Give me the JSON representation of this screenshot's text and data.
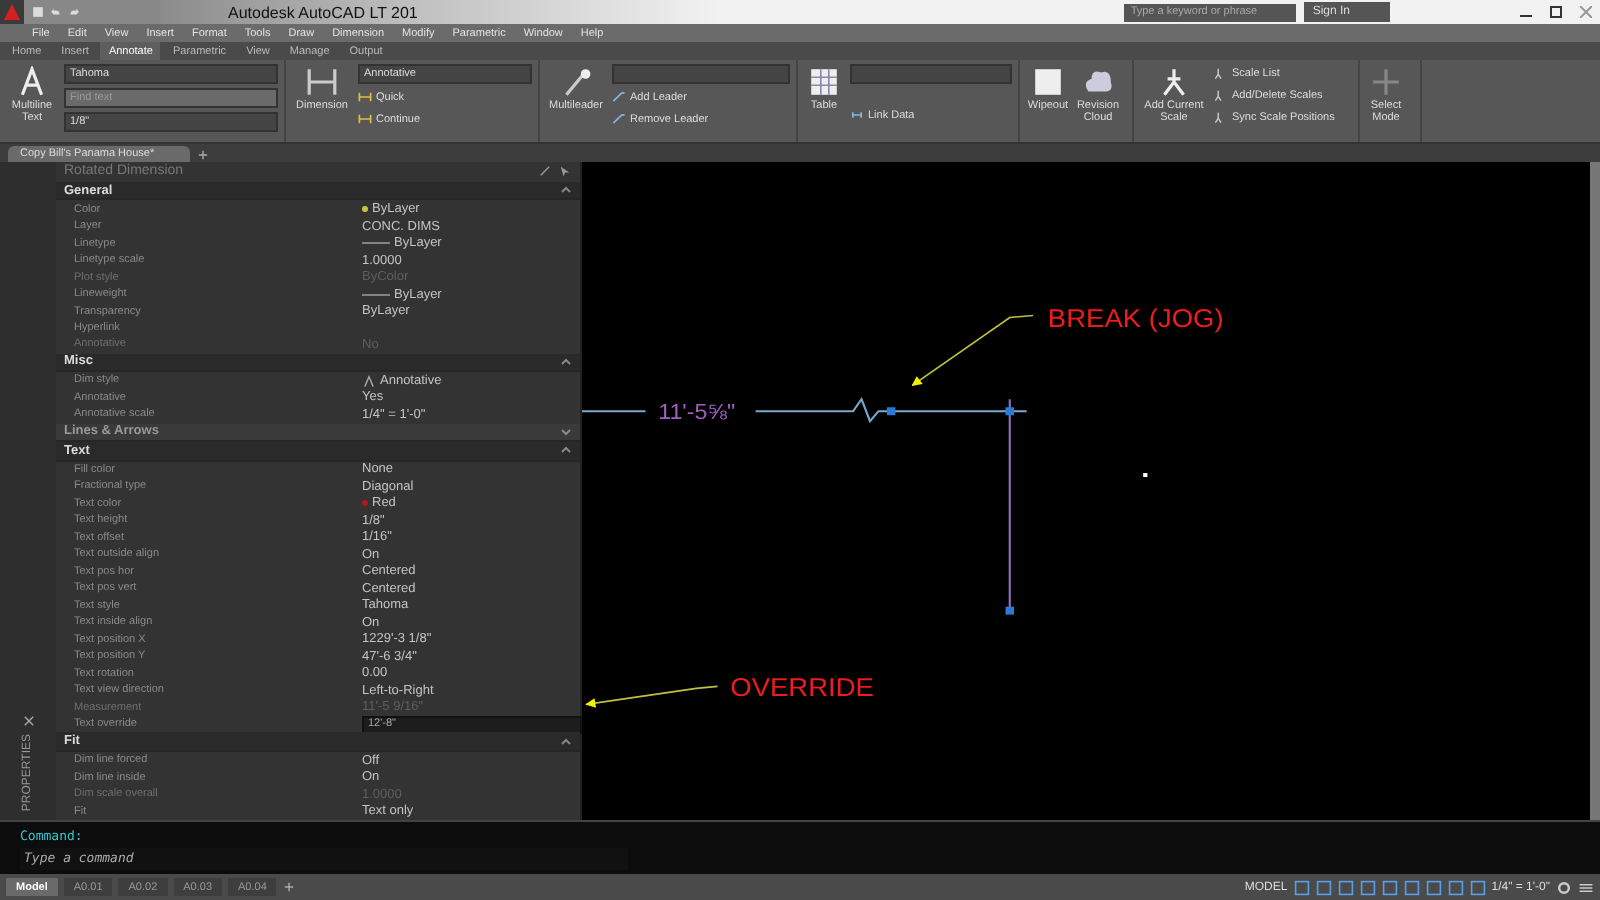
{
  "window": {
    "title": "Autodesk AutoCAD LT 201",
    "search": {
      "placeholder": "Type a keyword or phrase"
    },
    "sign_in": "Sign In"
  },
  "menu": [
    "File",
    "Edit",
    "View",
    "Insert",
    "Format",
    "Tools",
    "Draw",
    "Dimension",
    "Modify",
    "Parametric",
    "Window",
    "Help"
  ],
  "ribbon": {
    "tabs": [
      {
        "label": "Home",
        "selected": false
      },
      {
        "label": "Insert",
        "selected": false
      },
      {
        "label": "Annotate",
        "selected": true
      },
      {
        "label": "Parametric",
        "selected": false
      },
      {
        "label": "View",
        "selected": false
      },
      {
        "label": "Manage",
        "selected": false
      },
      {
        "label": "Output",
        "selected": false
      }
    ],
    "text_panel": {
      "big_button": "Multiline Text",
      "font": "Tahoma",
      "find_placeholder": "Find text",
      "height": "1/8\""
    },
    "dimension_panel": {
      "big_button": "Dimension",
      "style": "Annotative",
      "buttons": [
        "Quick",
        "Continue"
      ]
    },
    "leaders_panel": {
      "big_button": "Multileader",
      "buttons": [
        "Add Leader",
        "Remove Leader"
      ]
    },
    "table_panel": {
      "big_button": "Table",
      "buttons": [
        "Link Data"
      ]
    },
    "markup_panel": {
      "buttons": [
        "Wipeout",
        "Revision Cloud"
      ]
    },
    "scaling_panel": {
      "big_button": "Add Current Scale",
      "buttons": [
        "Scale List",
        "Add/Delete Scales",
        "Sync Scale Positions"
      ]
    },
    "select_mode": "Select Mode"
  },
  "file_tabs": [
    {
      "label": "Copy Bill's Panama House*",
      "selected": true
    }
  ],
  "properties": {
    "title": "Rotated Dimension",
    "palette_label": "PROPERTIES",
    "sections": [
      {
        "name": "General",
        "expanded": true,
        "rows": [
          {
            "label": "Color",
            "value": "ByLayer",
            "kind": "color",
            "color": "#c8c83c",
            "disabled": false
          },
          {
            "label": "Layer",
            "value": "CONC. DIMS",
            "kind": "text",
            "disabled": false
          },
          {
            "label": "Linetype",
            "value": "ByLayer",
            "kind": "linetype",
            "disabled": false
          },
          {
            "label": "Linetype scale",
            "value": "1.0000",
            "kind": "text",
            "disabled": false
          },
          {
            "label": "Plot style",
            "value": "ByColor",
            "kind": "text",
            "disabled": true
          },
          {
            "label": "Lineweight",
            "value": "ByLayer",
            "kind": "linetype",
            "disabled": false
          },
          {
            "label": "Transparency",
            "value": "ByLayer",
            "kind": "text",
            "disabled": false
          },
          {
            "label": "Hyperlink",
            "kind": "text",
            "disabled": false
          },
          {
            "label": "Annotative",
            "value": "No",
            "kind": "text",
            "disabled": true
          }
        ]
      },
      {
        "name": "Misc",
        "expanded": true,
        "rows": [
          {
            "label": "Dim style",
            "value": "Annotative",
            "kind": "annotative",
            "disabled": false
          },
          {
            "label": "Annotative",
            "value": "Yes",
            "kind": "text",
            "disabled": false
          },
          {
            "label": "Annotative scale",
            "value": "1/4\" = 1'-0\"",
            "kind": "text",
            "disabled": false
          }
        ]
      },
      {
        "name": "Lines & Arrows",
        "expanded": false
      },
      {
        "name": "Text",
        "expanded": true,
        "rows": [
          {
            "label": "Fill color",
            "value": "None",
            "kind": "text",
            "disabled": false
          },
          {
            "label": "Fractional type",
            "value": "Diagonal",
            "kind": "text",
            "disabled": false
          },
          {
            "label": "Text color",
            "value": "Red",
            "kind": "color",
            "color": "#b01818",
            "disabled": false
          },
          {
            "label": "Text height",
            "value": "1/8\"",
            "kind": "text",
            "disabled": false
          },
          {
            "label": "Text offset",
            "value": "1/16\"",
            "kind": "text",
            "disabled": false
          },
          {
            "label": "Text outside align",
            "value": "On",
            "kind": "text",
            "disabled": false
          },
          {
            "label": "Text pos hor",
            "value": "Centered",
            "kind": "text",
            "disabled": false
          },
          {
            "label": "Text pos vert",
            "value": "Centered",
            "kind": "text",
            "disabled": false
          },
          {
            "label": "Text style",
            "value": "Tahoma",
            "kind": "text",
            "disabled": false
          },
          {
            "label": "Text inside align",
            "value": "On",
            "kind": "text",
            "disabled": false
          },
          {
            "label": "Text position X",
            "value": "1229'-3 1/8\"",
            "kind": "text",
            "disabled": false
          },
          {
            "label": "Text position Y",
            "value": "47'-6 3/4\"",
            "kind": "text",
            "disabled": false
          },
          {
            "label": "Text rotation",
            "value": "0.00",
            "kind": "text",
            "disabled": false
          },
          {
            "label": "Text view direction",
            "value": "Left-to-Right",
            "kind": "text",
            "disabled": false
          },
          {
            "label": "Measurement",
            "value": "11'-5 9/16\"",
            "kind": "text",
            "disabled": true
          },
          {
            "label": "Text override",
            "value": "12'-8\"",
            "kind": "field",
            "disabled": false
          }
        ]
      },
      {
        "name": "Fit",
        "expanded": true,
        "rows": [
          {
            "label": "Dim line forced",
            "value": "Off",
            "kind": "text",
            "disabled": false
          },
          {
            "label": "Dim line inside",
            "value": "On",
            "kind": "text",
            "disabled": false
          },
          {
            "label": "Dim scale overall",
            "value": "1.0000",
            "kind": "text",
            "disabled": true
          },
          {
            "label": "Fit",
            "value": "Text only",
            "kind": "text",
            "disabled": false
          }
        ]
      }
    ]
  },
  "drawing": {
    "dimension_text": "11'-5⅝\"",
    "annotations": [
      {
        "text": "BREAK (JOG)"
      },
      {
        "text": "OVERRIDE"
      }
    ]
  },
  "command_line": {
    "history": "Command:",
    "placeholder": "Type a command"
  },
  "status_bar": {
    "layout_tabs": [
      {
        "label": "Model",
        "selected": true
      },
      {
        "label": "A0.01",
        "selected": false
      },
      {
        "label": "A0.02",
        "selected": false
      },
      {
        "label": "A0.03",
        "selected": false
      },
      {
        "label": "A0.04",
        "selected": false
      }
    ],
    "space": "MODEL",
    "scale": "1/4\" = 1'-0\""
  }
}
